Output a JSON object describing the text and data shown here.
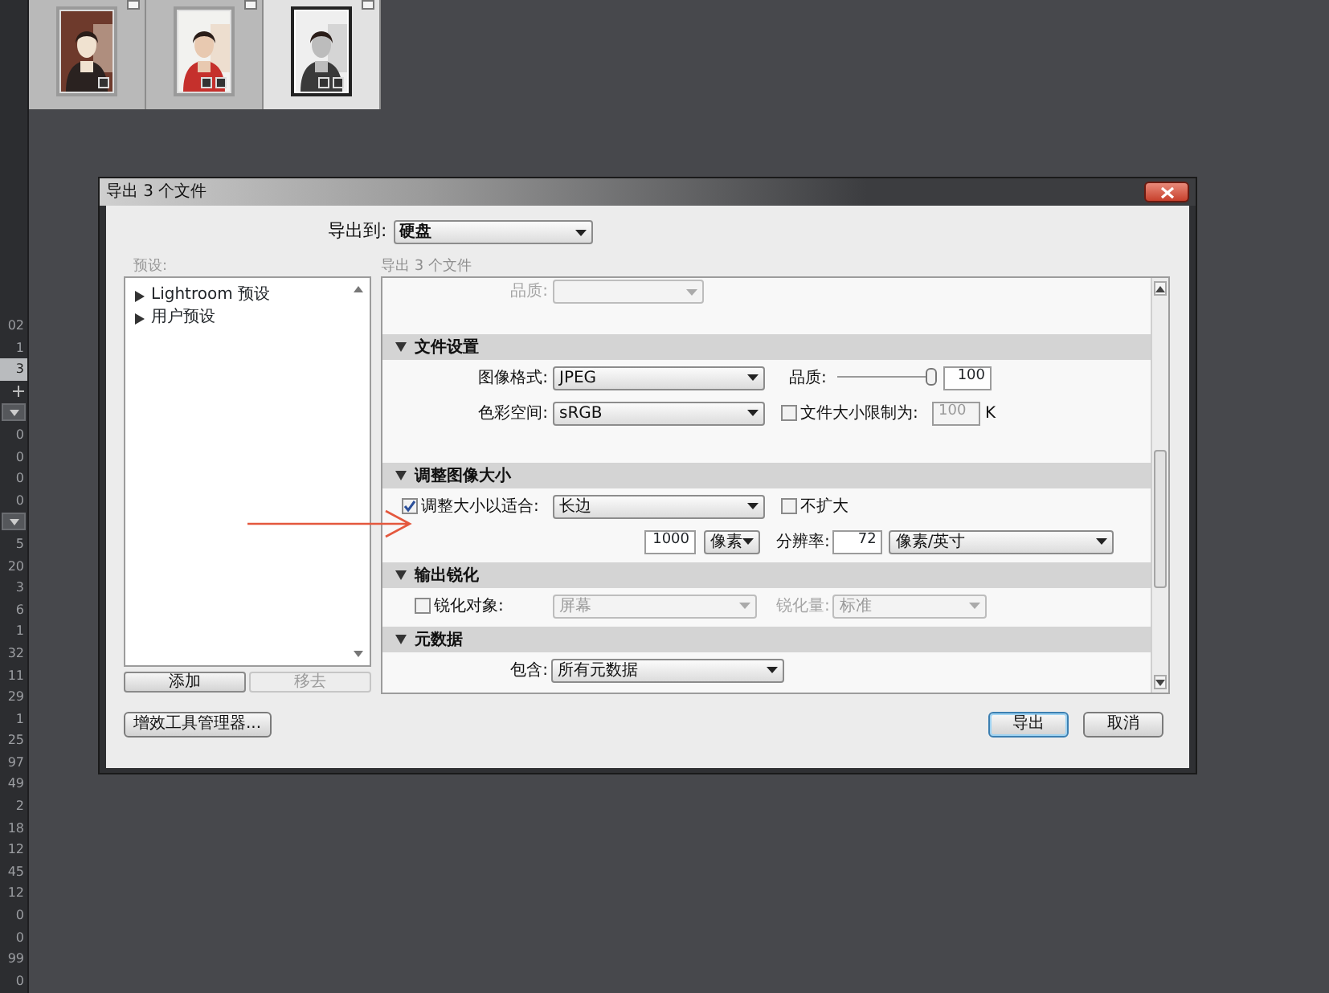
{
  "filmstrip": [
    {
      "selected": false
    },
    {
      "selected": false
    },
    {
      "selected": true
    }
  ],
  "side_column": [
    {
      "kind": "number",
      "text": "02",
      "selected": false
    },
    {
      "kind": "number",
      "text": "1",
      "selected": false
    },
    {
      "kind": "number",
      "text": "3",
      "selected": true
    },
    {
      "kind": "add"
    },
    {
      "kind": "toggle"
    },
    {
      "kind": "number",
      "text": "0",
      "selected": false
    },
    {
      "kind": "number",
      "text": "0",
      "selected": false
    },
    {
      "kind": "number",
      "text": "0",
      "selected": false
    },
    {
      "kind": "number",
      "text": "0",
      "selected": false
    },
    {
      "kind": "toggle"
    },
    {
      "kind": "number",
      "text": "5",
      "selected": false
    },
    {
      "kind": "number",
      "text": "20",
      "selected": false
    },
    {
      "kind": "number",
      "text": "3",
      "selected": false
    },
    {
      "kind": "number",
      "text": "6",
      "selected": false
    },
    {
      "kind": "number",
      "text": "1",
      "selected": false
    },
    {
      "kind": "number",
      "text": "32",
      "selected": false
    },
    {
      "kind": "number",
      "text": "11",
      "selected": false
    },
    {
      "kind": "number",
      "text": "29",
      "selected": false
    },
    {
      "kind": "number",
      "text": "1",
      "selected": false
    },
    {
      "kind": "number",
      "text": "25",
      "selected": false
    },
    {
      "kind": "number",
      "text": "97",
      "selected": false
    },
    {
      "kind": "number",
      "text": "49",
      "selected": false
    },
    {
      "kind": "number",
      "text": "2",
      "selected": false
    },
    {
      "kind": "number",
      "text": "18",
      "selected": false
    },
    {
      "kind": "number",
      "text": "12",
      "selected": false
    },
    {
      "kind": "number",
      "text": "45",
      "selected": false
    },
    {
      "kind": "number",
      "text": "12",
      "selected": false
    },
    {
      "kind": "number",
      "text": "0",
      "selected": false
    },
    {
      "kind": "number",
      "text": "0",
      "selected": false
    },
    {
      "kind": "number",
      "text": "99",
      "selected": false
    },
    {
      "kind": "number",
      "text": "0",
      "selected": false
    }
  ],
  "dialog": {
    "title": "导出 3 个文件",
    "export_to": {
      "label": "导出到:",
      "value": "硬盘"
    },
    "presets": {
      "label": "预设:",
      "items": [
        {
          "label": "Lightroom 预设"
        },
        {
          "label": "用户预设"
        }
      ]
    },
    "add_button": {
      "label": "添加",
      "disabled": false
    },
    "remove_button": {
      "label": "移去",
      "disabled": true
    },
    "settings_caption": "导出 3 个文件",
    "settings": [
      {
        "kind": "row",
        "controls": [
          {
            "kind": "label",
            "text": "品质:",
            "disabled": true
          },
          {
            "kind": "select",
            "disabled": true
          }
        ]
      },
      {
        "kind": "header",
        "text": "文件设置",
        "expanded": true
      },
      {
        "kind": "row",
        "controls": [
          {
            "kind": "label",
            "text": "图像格式:",
            "disabled": false
          },
          {
            "kind": "select",
            "value": "JPEG",
            "disabled": false
          },
          {
            "kind": "label",
            "text": "品质:",
            "disabled": false
          },
          {
            "kind": "slider",
            "level": 0.95
          },
          {
            "kind": "input",
            "value": "100",
            "disabled": false
          }
        ]
      },
      {
        "kind": "row",
        "controls": [
          {
            "kind": "label",
            "text": "色彩空间:",
            "disabled": false
          },
          {
            "kind": "select",
            "value": "sRGB",
            "disabled": false
          },
          {
            "kind": "checkbox",
            "text": "文件大小限制为:",
            "checked": false
          },
          {
            "kind": "input",
            "value": "100",
            "disabled": true
          },
          {
            "kind": "label",
            "text": "K",
            "disabled": false
          }
        ]
      },
      {
        "kind": "header",
        "text": "调整图像大小",
        "expanded": true
      },
      {
        "kind": "row",
        "controls": [
          {
            "kind": "checkbox",
            "text": "调整大小以适合:",
            "checked": true
          },
          {
            "kind": "select",
            "value": "长边",
            "disabled": false
          },
          {
            "kind": "checkbox",
            "text": "不扩大",
            "checked": false
          }
        ]
      },
      {
        "kind": "row",
        "controls": [
          {
            "kind": "input",
            "value": "1000",
            "disabled": false
          },
          {
            "kind": "select",
            "value": "像素",
            "disabled": false
          },
          {
            "kind": "label",
            "text": "分辨率:",
            "disabled": false
          },
          {
            "kind": "input",
            "value": "72",
            "disabled": false
          },
          {
            "kind": "select",
            "value": "像素/英寸",
            "disabled": false
          }
        ]
      },
      {
        "kind": "header",
        "text": "输出锐化",
        "expanded": true
      },
      {
        "kind": "row",
        "controls": [
          {
            "kind": "checkbox",
            "text": "锐化对象:",
            "checked": false
          },
          {
            "kind": "select",
            "value": "屏幕",
            "disabled": true
          },
          {
            "kind": "label",
            "text": "锐化量:",
            "disabled": true
          },
          {
            "kind": "select",
            "value": "标准",
            "disabled": true
          }
        ]
      },
      {
        "kind": "header",
        "text": "元数据",
        "expanded": true
      },
      {
        "kind": "row",
        "controls": [
          {
            "kind": "label",
            "text": "包含:",
            "disabled": false
          },
          {
            "kind": "select",
            "value": "所有元数据",
            "disabled": false
          }
        ]
      }
    ],
    "plugin_button": {
      "label": "增效工具管理器..."
    },
    "export_button": {
      "label": "导出",
      "default": true
    },
    "cancel_button": {
      "label": "取消",
      "default": false
    }
  }
}
